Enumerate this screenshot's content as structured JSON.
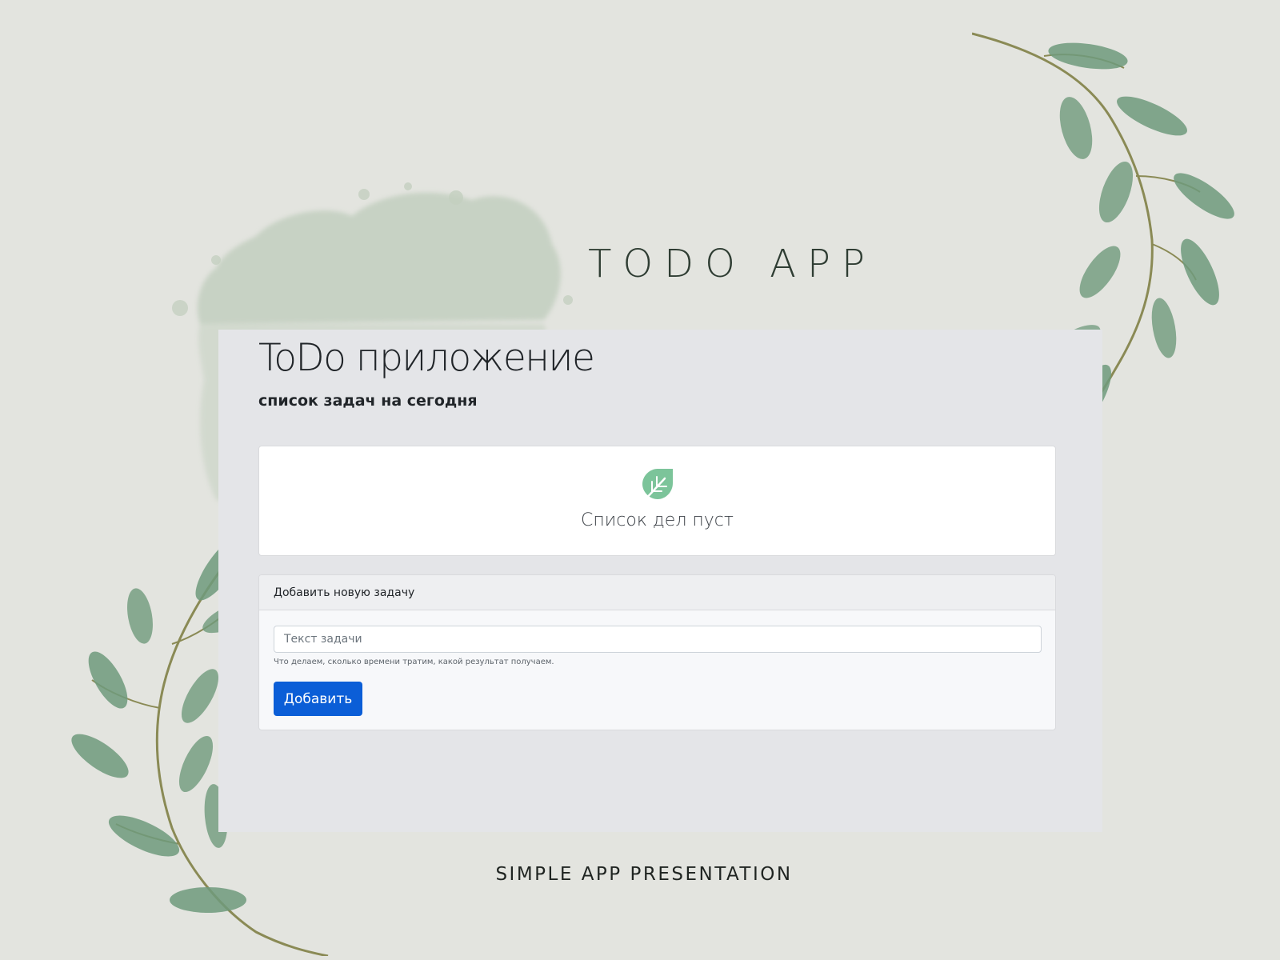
{
  "slide": {
    "title": "TODO APP",
    "footer": "SIMPLE APP PRESENTATION"
  },
  "app": {
    "title": "ToDo приложение",
    "subtitle": "список задач на сегодня",
    "empty_state": {
      "icon": "leaf-icon",
      "text": "Список дел пуст"
    },
    "add_task": {
      "header": "Добавить новую задачу",
      "input_value": "",
      "input_placeholder": "Текст задачи",
      "help_text": "Что делаем, сколько времени тратим, какой результат получаем.",
      "button_label": "Добавить"
    }
  },
  "colors": {
    "background": "#e3e4df",
    "panel": "#e4e5e8",
    "primary_button": "#0b5ed7",
    "leaf_green": "#6f9a7c",
    "branch_stem": "#8a8a55",
    "empty_icon": "#7cc49a"
  }
}
